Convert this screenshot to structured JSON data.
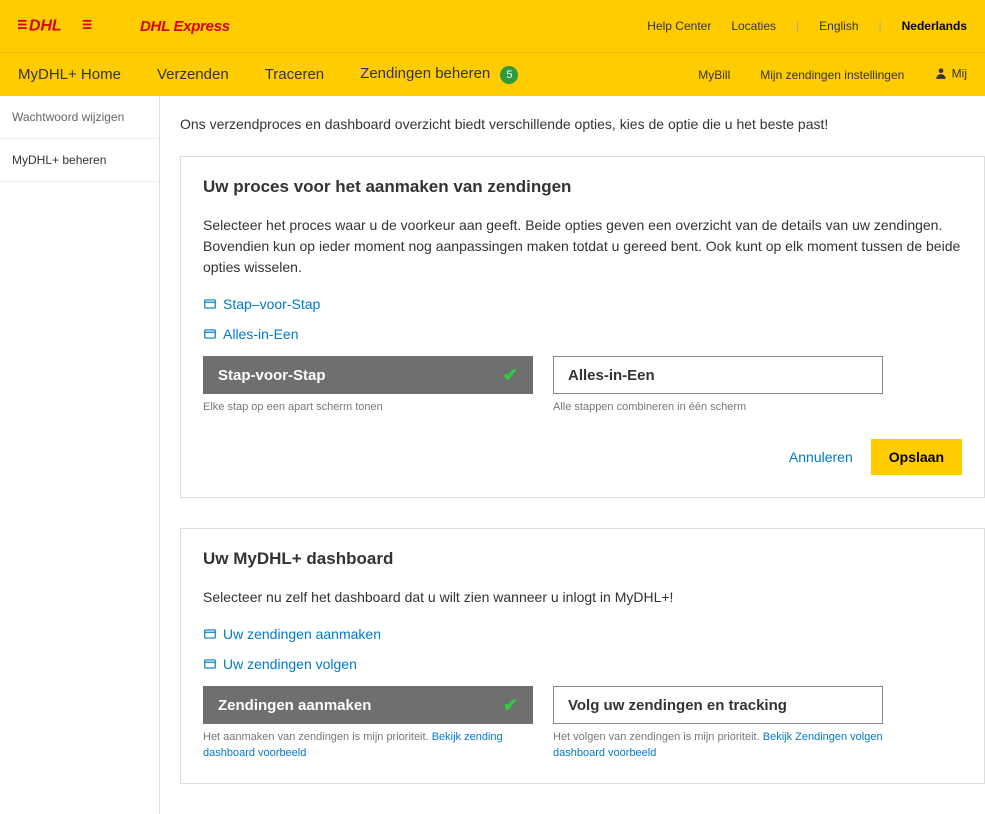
{
  "header": {
    "brand": "DHL Express",
    "help": "Help Center",
    "locations": "Locaties",
    "lang_en": "English",
    "lang_nl": "Nederlands"
  },
  "nav": {
    "home": "MyDHL+ Home",
    "send": "Verzenden",
    "track": "Traceren",
    "manage": "Zendingen beheren",
    "badge": "5",
    "mybill": "MyBill",
    "settings": "Mijn zendingen instellingen",
    "user": "Mij"
  },
  "sidebar": {
    "password": "Wachtwoord wijzigen",
    "manage": "MyDHL+ beheren"
  },
  "intro": "Ons verzendproces en dashboard overzicht biedt verschillende opties, kies de optie die u het beste past!",
  "panel1": {
    "title": "Uw proces voor het aanmaken van zendingen",
    "desc": "Selecteer het proces waar u de voorkeur aan geeft. Beide opties geven een overzicht van de details van uw zendingen. Bovendien kun op ieder moment nog aanpassingen maken totdat u gereed bent. Ook kunt op elk moment tussen de beide opties wisselen.",
    "link1": "Stap–voor-Stap",
    "link2": "Alles-in-Een",
    "opt1": "Stap-voor-Stap",
    "opt1cap": "Elke stap op een apart scherm tonen",
    "opt2": "Alles-in-Een",
    "opt2cap": "Alle stappen combineren in één scherm",
    "cancel": "Annuleren",
    "save": "Opslaan"
  },
  "panel2": {
    "title": "Uw MyDHL+ dashboard",
    "desc": "Selecteer nu zelf het dashboard dat u wilt zien wanneer u inlogt in MyDHL+!",
    "link1": "Uw zendingen aanmaken",
    "link2": "Uw zendingen volgen",
    "opt1": "Zendingen aanmaken",
    "opt1cap_pre": "Het aanmaken van zendingen is mijn prioriteit. ",
    "opt1cap_link": "Bekijk zending dashboard voorbeeld",
    "opt2": "Volg uw zendingen en tracking",
    "opt2cap_pre": "Het volgen van zendingen is mijn prioriteit. ",
    "opt2cap_link": "Bekijk Zendingen volgen dashboard voorbeeld"
  }
}
